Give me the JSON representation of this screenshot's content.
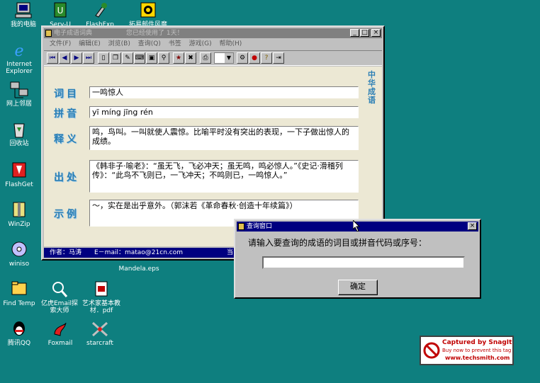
{
  "desktop": {
    "icons": [
      {
        "label": "我的电脑",
        "icon": "my-computer-icon"
      },
      {
        "label": "Serv-U",
        "icon": "serv-u-icon"
      },
      {
        "label": "FlashFxp",
        "icon": "flashfxp-icon"
      },
      {
        "label": "拓易邮件风靡",
        "icon": "mail-app-icon"
      },
      {
        "label": "Internet Explorer",
        "icon": "internet-explorer-icon"
      },
      {
        "label": "网上邻居",
        "icon": "network-neighborhood-icon"
      },
      {
        "label": "回收站",
        "icon": "recycle-bin-icon"
      },
      {
        "label": "FlashGet",
        "icon": "flashget-icon"
      },
      {
        "label": "WinZip",
        "icon": "winzip-icon"
      },
      {
        "label": "winiso",
        "icon": "winiso-icon"
      },
      {
        "label": "Find Temp",
        "icon": "find-temp-icon"
      },
      {
        "label": "亿虎Email探索大师",
        "icon": "email-explorer-icon"
      },
      {
        "label": "艺术家基本教材．pdf",
        "icon": "pdf-file-icon"
      },
      {
        "label": "腾讯QQ",
        "icon": "qq-icon"
      },
      {
        "label": "Foxmail",
        "icon": "foxmail-icon"
      },
      {
        "label": "starcraft",
        "icon": "starcraft-icon"
      },
      {
        "label": "Mandela.eps",
        "icon": "eps-file-icon"
      }
    ]
  },
  "main_window": {
    "title": "电子成语词典",
    "title_extra": "您已经使用了 1天！",
    "menu": [
      "文件(F)",
      "编辑(E)",
      "浏览(B)",
      "查询(Q)",
      "书签",
      "游戏(G)",
      "帮助(H)"
    ],
    "side_text": "中华成语",
    "fields": {
      "word_label": "词目",
      "word_value": "一鸣惊人",
      "pinyin_label": "拼音",
      "pinyin_value": "yī míng jīng rén",
      "meaning_label": "释义",
      "meaning_value": "鸣，鸟叫。一叫就使人震惊。比喻平时没有突出的表现，一下子做出惊人的成绩。",
      "source_label": "出处",
      "source_value": "《韩非子·喻老》：“虽无飞，飞必冲天；虽无鸣，鸣必惊人。”《史记·滑稽列传》：“此鸟不飞则已，一飞冲天；不鸣则已，一鸣惊人。”",
      "example_label": "示例",
      "example_value": "～，实在是出乎意外。（郭沫若《革命春秋·创造十年续篇》）"
    },
    "status_text": "作者：马涛　　E－mail：matao@21cn.com",
    "status_extra": "当"
  },
  "dialog": {
    "title": "查询窗口",
    "prompt": "请输入要查询的成语的词目或拼音代码或序号：",
    "input_value": "",
    "ok_label": "确定"
  },
  "snagit": {
    "line1": "Captured by SnagIt",
    "line2": "Buy now to prevent this tag",
    "line3": "www.techsmith.com"
  },
  "colors": {
    "desktop": "#0e7f7f",
    "active_title": "#000080",
    "field_label": "#2b7fb5"
  }
}
